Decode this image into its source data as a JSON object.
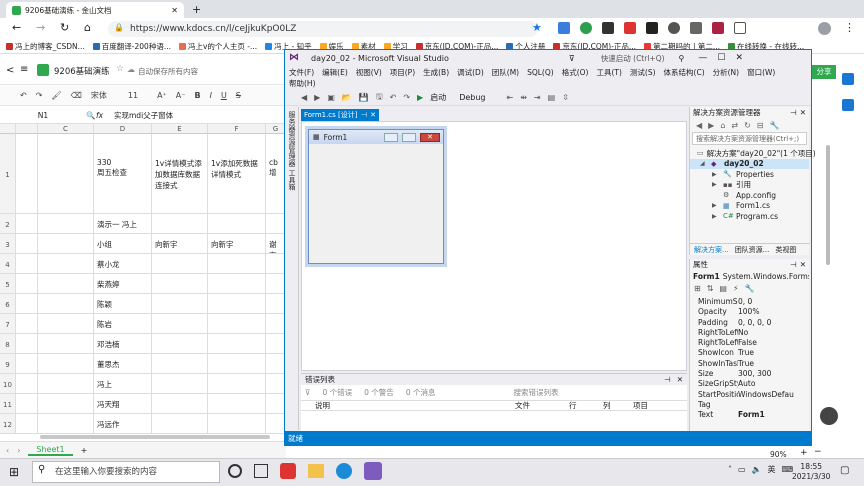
{
  "browser": {
    "tab_title": "9206基础演练 - 金山文档",
    "url": "https://www.kdocs.cn/l/ceJjkuKpO0LZ",
    "bookmarks": [
      "冯上的博客_CSDN...",
      "百度翻译-200种语...",
      "冯上v的个人主页 -...",
      "冯上 - 知乎",
      "娱乐",
      "素材",
      "学习",
      "京东(JD.COM)-正品...",
      "个人注册",
      "京东(JD.COM)-正品...",
      "第二期吗的 | 第二...",
      "在线转换 - 在线转..."
    ],
    "colors": {
      "tabbar": "#dee1e6",
      "accent": "#1a73e8"
    }
  },
  "wps": {
    "doc_title": "9206基础演练",
    "autosave": "自动保存所有内容",
    "font": "宋体",
    "size": "11",
    "cell_ref": "N1",
    "formula": "实现mdi父子窗体",
    "columns": [
      "C",
      "D",
      "E",
      "F",
      "G"
    ],
    "rows": [
      {
        "n": "1",
        "d": "330\n周五检查",
        "e": "1v详情模式添加数据库数据 连接式",
        "f": "1v添加死数据详情模式",
        "g": "cb增"
      },
      {
        "n": "2",
        "d": "演示一 冯上",
        "e": "",
        "f": "",
        "g": ""
      },
      {
        "n": "3",
        "d": "小组",
        "e": "向新宇",
        "f": "向新宇",
        "g": "谢宇"
      },
      {
        "n": "4",
        "d": "蔡小龙",
        "e": "",
        "f": "",
        "g": ""
      },
      {
        "n": "5",
        "d": "柴燕婷",
        "e": "",
        "f": "",
        "g": ""
      },
      {
        "n": "6",
        "d": "陈颖",
        "e": "",
        "f": "",
        "g": ""
      },
      {
        "n": "7",
        "d": "陈岩",
        "e": "",
        "f": "",
        "g": ""
      },
      {
        "n": "8",
        "d": "邓浩楠",
        "e": "",
        "f": "",
        "g": ""
      },
      {
        "n": "9",
        "d": "董思杰",
        "e": "",
        "f": "",
        "g": ""
      },
      {
        "n": "10",
        "d": "冯上",
        "e": "",
        "f": "",
        "g": ""
      },
      {
        "n": "11",
        "d": "冯天翔",
        "e": "",
        "f": "",
        "g": ""
      },
      {
        "n": "12",
        "d": "冯远作",
        "e": "",
        "f": "",
        "g": ""
      }
    ],
    "sheet": "Sheet1",
    "share": "分享"
  },
  "vs": {
    "title": "day20_02 - Microsoft Visual Studio",
    "quick_launch": "快速启动 (Ctrl+Q)",
    "menu1": [
      "文件(F)",
      "编辑(E)",
      "视图(V)",
      "项目(P)",
      "生成(B)",
      "调试(D)",
      "团队(M)",
      "SQL(Q)",
      "格式(O)",
      "工具(T)",
      "测试(S)",
      "体系结构(C)",
      "分析(N)",
      "窗口(W)"
    ],
    "menu2": "帮助(H)",
    "start": "启动",
    "config": "Debug",
    "side_labels": "服务器资源管理器  工具箱",
    "designer_tab": "Form1.cs [设计]",
    "form_title": "Form1",
    "errlist": {
      "title": "错误列表",
      "errors": "0 个错误",
      "warnings": "0 个警告",
      "messages": "0 个消息",
      "search": "搜索错误列表",
      "cols": [
        "说明",
        "文件",
        "行",
        "列",
        "项目"
      ]
    },
    "solution": {
      "title": "解决方案资源管理器",
      "search": "搜索解决方案资源管理器(Ctrl+;)",
      "items": [
        "解决方案\"day20_02\"(1 个项目)",
        "day20_02",
        "Properties",
        "引用",
        "App.config",
        "Form1.cs",
        "Program.cs"
      ],
      "tabs": [
        "解决方案...",
        "团队资源...",
        "类视图"
      ]
    },
    "props": {
      "title": "属性",
      "object": "Form1",
      "object_type": "System.Windows.Forms.",
      "rows": [
        [
          "MinimumSize",
          "0, 0"
        ],
        [
          "Opacity",
          "100%"
        ],
        [
          "Padding",
          "0, 0, 0, 0"
        ],
        [
          "RightToLeft",
          "No"
        ],
        [
          "RightToLeftLa",
          "False"
        ],
        [
          "ShowIcon",
          "True"
        ],
        [
          "ShowInTaskba",
          "True"
        ],
        [
          "Size",
          "300, 300"
        ],
        [
          "SizeGripStyle",
          "Auto"
        ],
        [
          "StartPosition",
          "WindowsDefau"
        ],
        [
          "Tag",
          ""
        ],
        [
          "Text",
          "Form1"
        ]
      ]
    },
    "status": "就绪"
  },
  "taskbar": {
    "search": "在这里输入你要搜索的内容",
    "time": "18:55",
    "date": "2021/3/30",
    "lang": "英",
    "zoom": "90%"
  }
}
